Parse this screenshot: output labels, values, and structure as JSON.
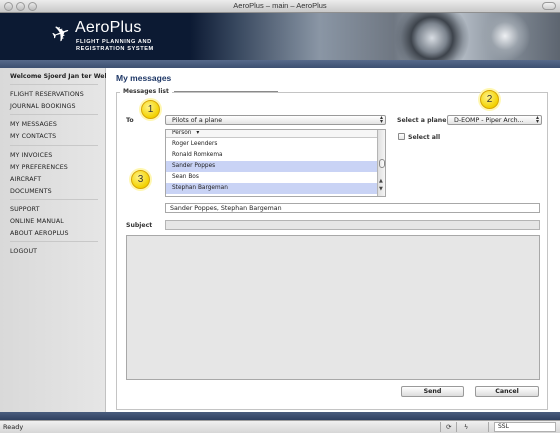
{
  "window": {
    "title": "AeroPlus – main – AeroPlus"
  },
  "header": {
    "logo_title": "AeroPlus",
    "logo_sub1": "FLIGHT PLANNING AND",
    "logo_sub2": "REGISTRATION SYSTEM",
    "plane_icon": "airplane-icon"
  },
  "sidebar": {
    "welcome": "Welcome Sjoerd Jan ter Welle",
    "items": [
      {
        "label": "FLIGHT RESERVATIONS"
      },
      {
        "label": "JOURNAL BOOKINGS"
      },
      {
        "label": "MY MESSAGES"
      },
      {
        "label": "MY CONTACTS"
      },
      {
        "label": "MY INVOICES"
      },
      {
        "label": "MY PREFERENCES"
      },
      {
        "label": "AIRCRAFT"
      },
      {
        "label": "DOCUMENTS"
      },
      {
        "label": "SUPPORT"
      },
      {
        "label": "ONLINE MANUAL"
      },
      {
        "label": "ABOUT AEROPLUS"
      },
      {
        "label": "LOGOUT"
      }
    ]
  },
  "main": {
    "title": "My messages",
    "legend": "Messages list",
    "to_label": "To",
    "to_select": "Pilots of a plane",
    "select_plane_label": "Select a plane",
    "plane_select": "D-EOMP - Piper Arch...",
    "select_all_label": "Select all",
    "list_header": "Person",
    "persons": [
      {
        "name": "Roger Leenders",
        "selected": false
      },
      {
        "name": "Ronald Romkema",
        "selected": false
      },
      {
        "name": "Sander Poppes",
        "selected": true
      },
      {
        "name": "Sean Bos",
        "selected": false
      },
      {
        "name": "Stephan Bargeman",
        "selected": true
      }
    ],
    "recipients": "Sander Poppes, Stephan Bargeman",
    "subject_label": "Subject",
    "subject_value": "",
    "send_label": "Send",
    "cancel_label": "Cancel"
  },
  "callouts": [
    "1",
    "2",
    "3"
  ],
  "status": {
    "text": "Ready",
    "ssl": "SSL"
  },
  "colors": {
    "accent": "#1e3766",
    "selection": "#c9d3f5",
    "callout": "#f2d200"
  }
}
